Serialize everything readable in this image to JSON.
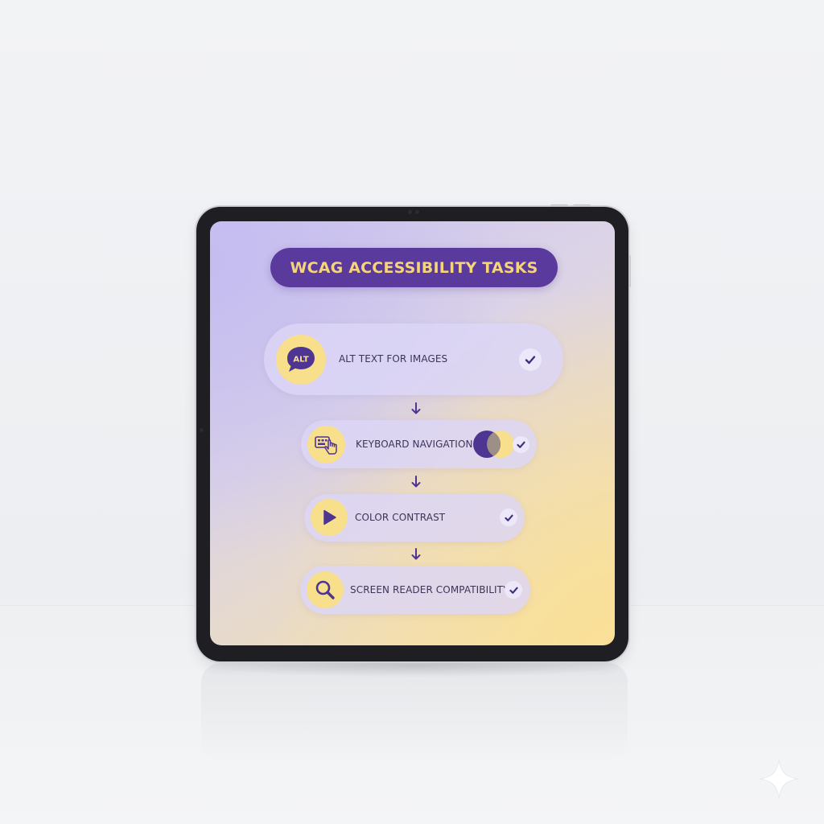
{
  "app": {
    "title": "WCAG ACCESSIBILITY TASKS"
  },
  "tasks": [
    {
      "label": "ALT TEXT FOR IMAGES",
      "icon": "alt-text-icon",
      "icon_text": "ALT",
      "completed": true
    },
    {
      "label": "KEYBOARD NAVIGATION",
      "icon": "keyboard-hand-icon",
      "completed": true
    },
    {
      "label": "COLOR CONTRAST",
      "icon": "play-icon",
      "completed": true
    },
    {
      "label": "SCREEN READER COMPATIBILITY",
      "icon": "magnifier-icon",
      "completed": true
    }
  ],
  "colors": {
    "title_bg": "#5a3a9c",
    "title_text": "#f6d47c",
    "accent_purple": "#4f3592",
    "accent_yellow": "#f8df8c",
    "card_bg": "#dcd6f6"
  }
}
